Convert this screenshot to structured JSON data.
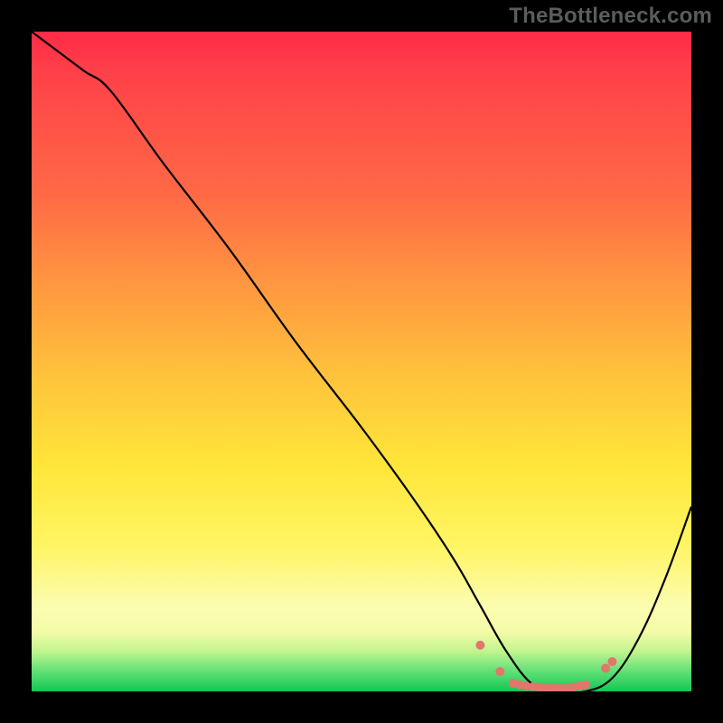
{
  "watermark": "TheBottleneck.com",
  "chart_data": {
    "type": "line",
    "title": "",
    "xlabel": "",
    "ylabel": "",
    "xlim": [
      0,
      100
    ],
    "ylim": [
      0,
      100
    ],
    "gradient_stops": [
      {
        "pos": 0,
        "color": "#ff2a47"
      },
      {
        "pos": 25,
        "color": "#ff6a45"
      },
      {
        "pos": 52,
        "color": "#ffc23c"
      },
      {
        "pos": 78,
        "color": "#fff564"
      },
      {
        "pos": 91,
        "color": "#f3fca8"
      },
      {
        "pos": 100,
        "color": "#14c654"
      }
    ],
    "series": [
      {
        "name": "bottleneck-curve",
        "x": [
          0,
          4,
          8,
          12,
          20,
          30,
          40,
          50,
          58,
          64,
          68,
          72,
          76,
          80,
          84,
          88,
          92,
          96,
          100
        ],
        "y": [
          100,
          97,
          94,
          91,
          80,
          67,
          53,
          40,
          29,
          20,
          13,
          6,
          1,
          0,
          0,
          2,
          8,
          17,
          28
        ]
      }
    ],
    "markers": {
      "name": "valley-markers",
      "color": "#e2766c",
      "x": [
        68,
        71,
        73,
        74,
        75,
        76,
        77,
        78,
        79,
        80,
        81,
        82,
        83,
        84,
        87,
        88
      ],
      "y": [
        7,
        3,
        1.2,
        1,
        0.8,
        0.7,
        0.6,
        0.5,
        0.5,
        0.5,
        0.5,
        0.6,
        0.8,
        1,
        3.5,
        4.5
      ]
    }
  }
}
